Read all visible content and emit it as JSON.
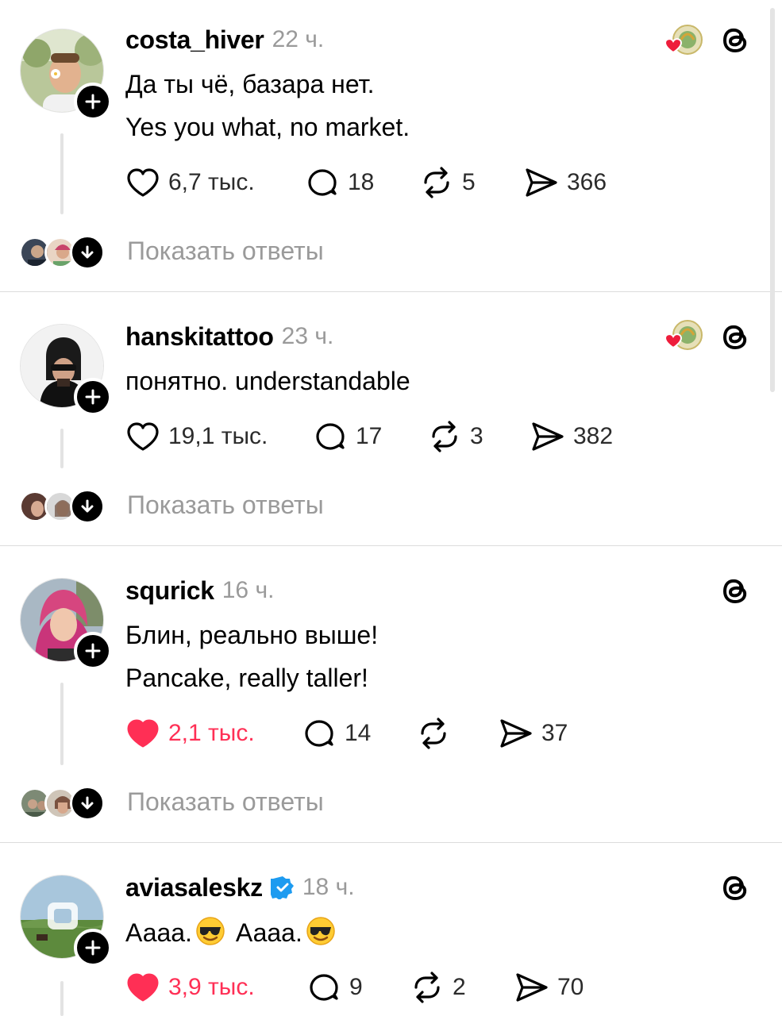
{
  "colors": {
    "like_red": "#ff2f55",
    "muted": "#9a9a9a",
    "verified_blue": "#1d9bf0",
    "divider": "#dcdcdc"
  },
  "posts": [
    {
      "username": "costa_hiver",
      "time": "22 ч.",
      "verified": false,
      "has_reaction_badge": true,
      "lines": [
        "Да ты чё, базара нет.",
        "Yes you what, no market."
      ],
      "likes": "6,7 тыс.",
      "liked": false,
      "comments": "18",
      "reposts": "5",
      "shares": "366",
      "show_replies": "Показать ответы"
    },
    {
      "username": "hanskitattoo",
      "time": "23 ч.",
      "verified": false,
      "has_reaction_badge": true,
      "lines": [
        "понятно. understandable"
      ],
      "likes": "19,1 тыс.",
      "liked": false,
      "comments": "17",
      "reposts": "3",
      "shares": "382",
      "show_replies": "Показать ответы"
    },
    {
      "username": "squrick",
      "time": "16 ч.",
      "verified": false,
      "has_reaction_badge": false,
      "lines": [
        "Блин, реально выше!",
        "Pancake, really taller!"
      ],
      "likes": "2,1 тыс.",
      "liked": true,
      "comments": "14",
      "reposts": "",
      "shares": "37",
      "show_replies": "Показать ответы"
    },
    {
      "username": "aviasaleskz",
      "time": "18 ч.",
      "verified": true,
      "has_reaction_badge": false,
      "line_parts": [
        "Аааа.",
        "Аааа."
      ],
      "emoji": "smiling-face-with-sunglasses",
      "likes": "3,9 тыс.",
      "liked": true,
      "comments": "9",
      "reposts": "2",
      "shares": "70"
    }
  ]
}
